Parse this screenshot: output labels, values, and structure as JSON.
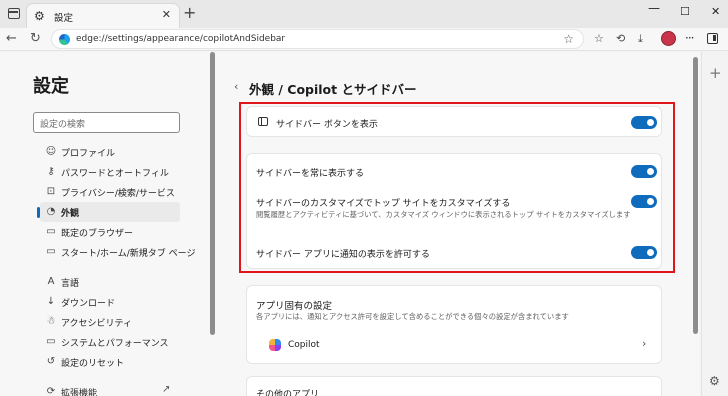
{
  "tab": {
    "title": "設定",
    "close": "✕"
  },
  "window_controls": {
    "minimize": "—",
    "maximize": "☐",
    "close": "✕"
  },
  "address": {
    "url": "edge://settings/appearance/copilotAndSidebar"
  },
  "nav": {
    "title": "設定",
    "search_placeholder": "設定の検索",
    "items": [
      {
        "label": "プロファイル",
        "icon": "profile-icon"
      },
      {
        "label": "パスワードとオートフィル",
        "icon": "key-icon"
      },
      {
        "label": "プライバシー/検索/サービス",
        "icon": "lock-icon"
      },
      {
        "label": "外観",
        "icon": "appearance-icon",
        "active": true
      },
      {
        "label": "既定のブラウザー",
        "icon": "browser-icon"
      },
      {
        "label": "スタート/ホーム/新規タブ ページ",
        "icon": "home-icon"
      },
      {
        "label": "言語",
        "icon": "language-icon"
      },
      {
        "label": "ダウンロード",
        "icon": "download-icon"
      },
      {
        "label": "アクセシビリティ",
        "icon": "accessibility-icon"
      },
      {
        "label": "システムとパフォーマンス",
        "icon": "system-icon"
      },
      {
        "label": "設定のリセット",
        "icon": "reset-icon"
      },
      {
        "label": "拡張機能",
        "icon": "extensions-icon"
      }
    ]
  },
  "content": {
    "breadcrumb": "外観 / Copilot とサイドバー",
    "show_sidebar_button": {
      "label": "サイドバー ボタンを表示",
      "on": true
    },
    "always_show_sidebar": {
      "label": "サイドバーを常に表示する",
      "on": true
    },
    "customize_top_sites": {
      "label": "サイドバーのカスタマイズでトップ サイトをカスタマイズする",
      "desc": "閲覧履歴とアクティビティに基づいて、カスタマイズ ウィンドウに表示されるトップ サイトをカスタマイズします",
      "on": true
    },
    "allow_notifications": {
      "label": "サイドバー アプリに通知の表示を許可する",
      "on": true
    },
    "app_settings": {
      "title": "アプリ固有の設定",
      "desc": "各アプリには、通知とアクセス許可を設定して含めることができる個々の設定が含まれています",
      "copilot_label": "Copilot"
    },
    "other_apps_title": "その他のアプリ"
  },
  "colors": {
    "toggle_on": "#0f6cbd",
    "highlight": "#e0161c",
    "active_indicator": "#0f6cbd"
  }
}
